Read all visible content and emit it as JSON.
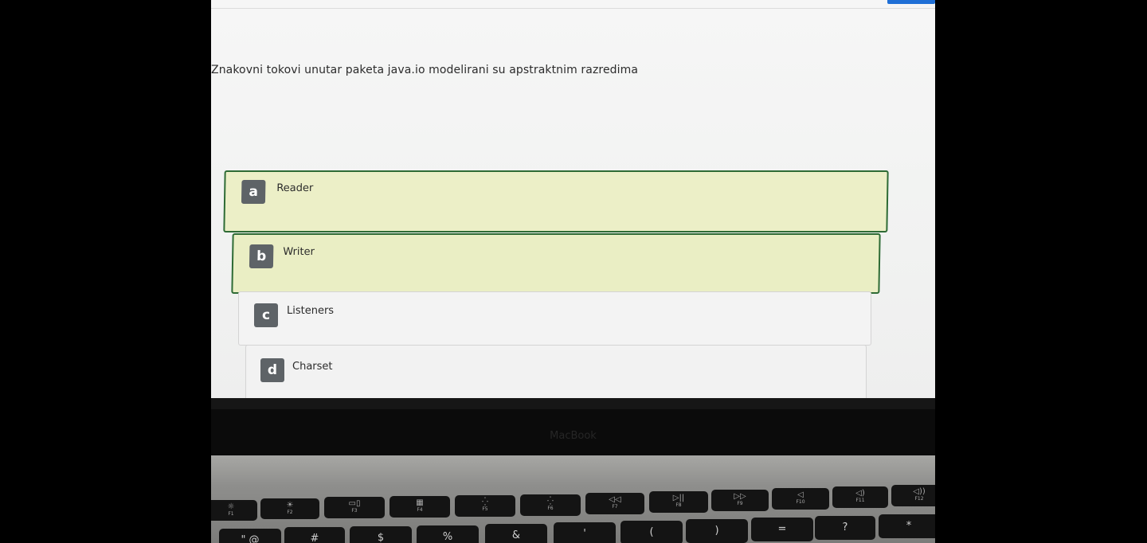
{
  "quiz": {
    "question": "Znakovni tokovi unutar paketa java.io modelirani su apstraktnim razredima",
    "options": [
      {
        "letter": "a",
        "label": "Reader",
        "state": "selected"
      },
      {
        "letter": "b",
        "label": "Writer",
        "state": "selected"
      },
      {
        "letter": "c",
        "label": "Listeners",
        "state": "unselected"
      },
      {
        "letter": "d",
        "label": "Charset",
        "state": "unselected"
      }
    ]
  },
  "laptop": {
    "brand": "MacBook"
  },
  "keyboard": {
    "function_keys": [
      {
        "glyph": "☼",
        "label": "F1"
      },
      {
        "glyph": "☀",
        "label": "F2"
      },
      {
        "glyph": "▭▯",
        "label": "F3"
      },
      {
        "glyph": "▦",
        "label": "F4"
      },
      {
        "glyph": "⁛",
        "label": "F5"
      },
      {
        "glyph": "⁛",
        "label": "F6"
      },
      {
        "glyph": "◁◁",
        "label": "F7"
      },
      {
        "glyph": "▷||",
        "label": "F8"
      },
      {
        "glyph": "▷▷",
        "label": "F9"
      },
      {
        "glyph": "◁",
        "label": "F10"
      },
      {
        "glyph": "◁)",
        "label": "F11"
      },
      {
        "glyph": "◁))",
        "label": "F12"
      }
    ],
    "number_row": [
      "\" @",
      "#",
      "$",
      "%",
      "&",
      "'",
      "(",
      ")",
      "=",
      "?",
      "*"
    ]
  },
  "colors": {
    "selected_border": "#2e6b35",
    "selected_fill": "#ecefc7",
    "letter_badge": "#5e6367",
    "accent_button": "#1f6fd6"
  }
}
